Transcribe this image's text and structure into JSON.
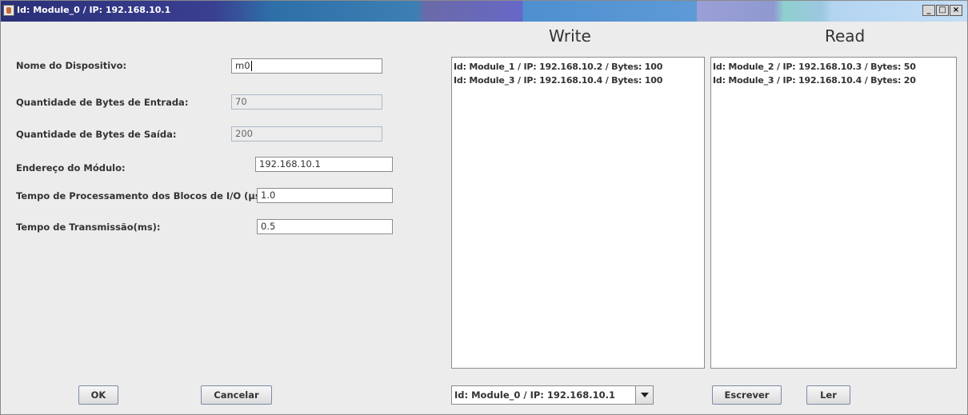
{
  "window": {
    "title": "Id: Module_0 / IP: 192.168.10.1",
    "minimize_glyph": "_",
    "maximize_glyph": "□",
    "close_glyph": "×"
  },
  "form": {
    "device_name_label": "Nome do Dispositivo:",
    "device_name_value": "m0",
    "input_bytes_label": "Quantidade de Bytes de Entrada:",
    "input_bytes_value": "70",
    "output_bytes_label": "Quantidade de Bytes de Saída:",
    "output_bytes_value": "200",
    "address_label": "Endereço do Módulo:",
    "address_value": "192.168.10.1",
    "processing_time_label": "Tempo de Processamento dos Blocos de I/O (µs):",
    "processing_time_value": "1.0",
    "transmission_time_label": "Tempo de Transmissão(ms):",
    "transmission_time_value": "0.5"
  },
  "write": {
    "heading": "Write",
    "items": [
      "Id: Module_1 / IP: 192.168.10.2 / Bytes: 100",
      "Id: Module_3 / IP: 192.168.10.4 / Bytes: 100"
    ]
  },
  "read": {
    "heading": "Read",
    "items": [
      "Id: Module_2 / IP: 192.168.10.3 / Bytes: 50",
      "Id: Module_3 / IP: 192.168.10.4 / Bytes: 20"
    ]
  },
  "buttons": {
    "ok": "OK",
    "cancel": "Cancelar",
    "write": "Escrever",
    "read": "Ler"
  },
  "module_select": {
    "selected": "Id: Module_0 / IP: 192.168.10.1"
  }
}
